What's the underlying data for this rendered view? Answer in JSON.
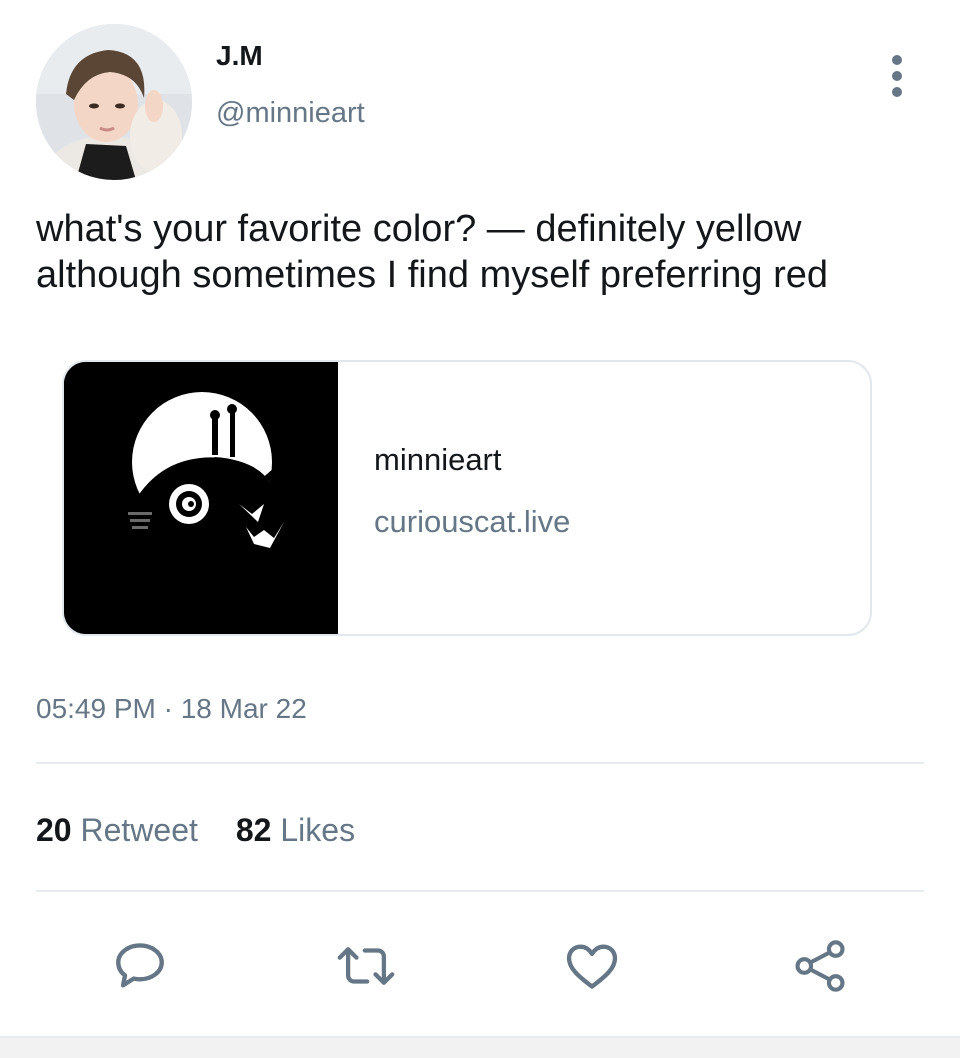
{
  "tweet": {
    "author": {
      "display_name": "J.M",
      "handle": "@minnieart"
    },
    "text": "what's your favorite color? — definitely yellow although sometimes I find myself preferring red",
    "card": {
      "title": "minnieart",
      "domain": "curiouscat.live"
    },
    "timestamp": "05:49 PM · 18 Mar 22",
    "stats": {
      "retweet_count": "20",
      "retweet_label": "Retweet",
      "likes_count": "82",
      "likes_label": "Likes"
    },
    "actions": [
      {
        "icon": "reply-icon"
      },
      {
        "icon": "retweet-icon"
      },
      {
        "icon": "like-icon"
      },
      {
        "icon": "share-icon"
      }
    ]
  },
  "colors": {
    "text_primary": "#14171a",
    "text_secondary": "#657786",
    "border": "#e1e8ed",
    "divider": "#e6ecf0"
  }
}
